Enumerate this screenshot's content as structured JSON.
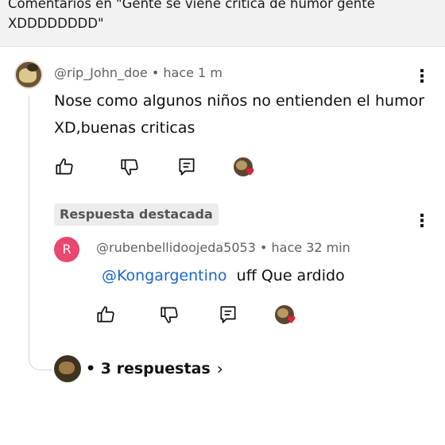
{
  "header": {
    "title": "Comentarios en \"Gente se viene critica de humor gente XDDDDDDDD\""
  },
  "comment": {
    "author": "@rip_John_doe",
    "time": "hace 1 m",
    "text": "Nose como algunos niños no entienden el humor XD,buenas criticas"
  },
  "highlighted": {
    "badge": "Respuesta destacada",
    "avatar_initial": "R",
    "author": "@rubenbellidoojeda5053",
    "time": "hace 32 min",
    "mention": "@Kongargentino",
    "text": "uff Que ardido"
  },
  "replies": {
    "label": "• 3 respuestas",
    "chevron": "›"
  },
  "icons": [
    "like-icon",
    "dislike-icon",
    "reply-icon",
    "creator-heart-icon",
    "more-vert-icon",
    "chevron-right-icon"
  ],
  "colors": {
    "accent_link": "#1a66c8",
    "heart": "#e3213a",
    "avatar_r": "#e8476f"
  }
}
